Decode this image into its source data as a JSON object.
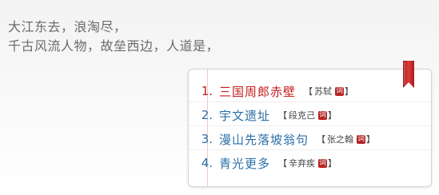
{
  "poem": {
    "line1": "大江东去，浪淘尽，",
    "line2": "千古风流人物，故垒西边，人道是，"
  },
  "ribbon_color": "#c82a2a",
  "list": {
    "items": [
      {
        "number": "1.",
        "title": "三国周郎赤壁",
        "author": "苏轼",
        "badge": "词",
        "active": true
      },
      {
        "number": "2.",
        "title": "宇文遗址",
        "author": "段克己",
        "badge": "词",
        "active": false
      },
      {
        "number": "3.",
        "title": "漫山先落坡翁句",
        "author": "张之翰",
        "badge": "词",
        "active": false
      },
      {
        "number": "4.",
        "title": "青光更多",
        "author": "辛弃疾",
        "badge": "词",
        "active": false
      }
    ],
    "bracket_open": "【",
    "bracket_close": "】"
  }
}
